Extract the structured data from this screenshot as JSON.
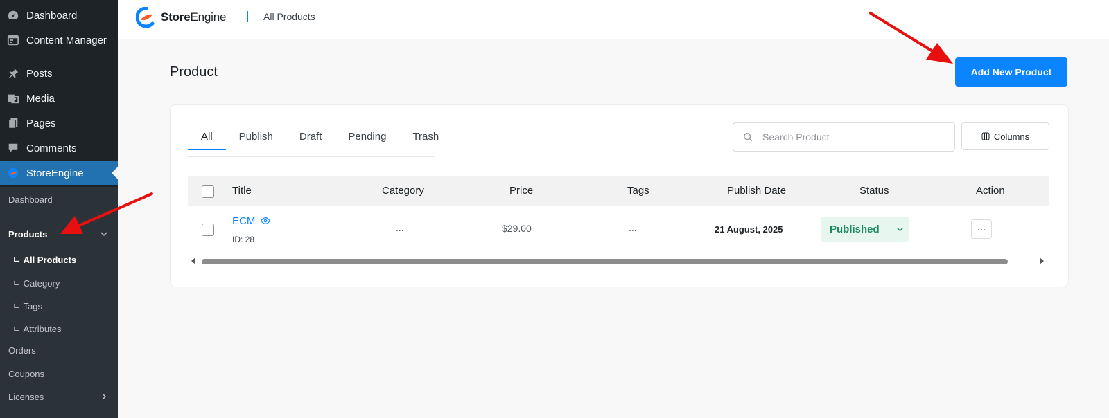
{
  "sidebar": {
    "items": [
      {
        "label": "Dashboard",
        "icon": "dashboard-icon"
      },
      {
        "label": "Content Manager",
        "icon": "content-manager-icon"
      },
      {
        "label": "Posts",
        "icon": "pin-icon"
      },
      {
        "label": "Media",
        "icon": "media-icon"
      },
      {
        "label": "Pages",
        "icon": "pages-icon"
      },
      {
        "label": "Comments",
        "icon": "comment-icon"
      },
      {
        "label": "StoreEngine",
        "icon": "storeengine-icon",
        "active": true
      }
    ],
    "submenu": {
      "dashboard": "Dashboard",
      "products": "Products",
      "all_products": "ㄴ All Products",
      "category": "ㄴ Category",
      "tags": "ㄴ Tags",
      "attributes": "ㄴ Attributes",
      "orders": "Orders",
      "coupons": "Coupons",
      "licenses": "Licenses"
    }
  },
  "header": {
    "brand_bold": "Store",
    "brand_light": "Engine",
    "breadcrumb": "All Products"
  },
  "main": {
    "title": "Product",
    "add_button": "Add New Product",
    "tabs": [
      "All",
      "Publish",
      "Draft",
      "Pending",
      "Trash"
    ],
    "search_placeholder": "Search Product",
    "columns_button": "Columns",
    "table": {
      "headers": {
        "title": "Title",
        "category": "Category",
        "price": "Price",
        "tags": "Tags",
        "publish_date": "Publish Date",
        "status": "Status",
        "action": "Action"
      },
      "rows": [
        {
          "title": "ECM",
          "id": "ID: 28",
          "category": "...",
          "price": "$29.00",
          "tags": "...",
          "publish_date": "21 August, 2025",
          "status": "Published",
          "action": "···"
        }
      ]
    }
  },
  "colors": {
    "accent": "#0a84ff",
    "sidebar": "#1d2327",
    "active_menu": "#2271b1",
    "status_bg": "#e7f6ef",
    "status_text": "#1e8a5f",
    "annotation_arrow": "#e8100f"
  }
}
